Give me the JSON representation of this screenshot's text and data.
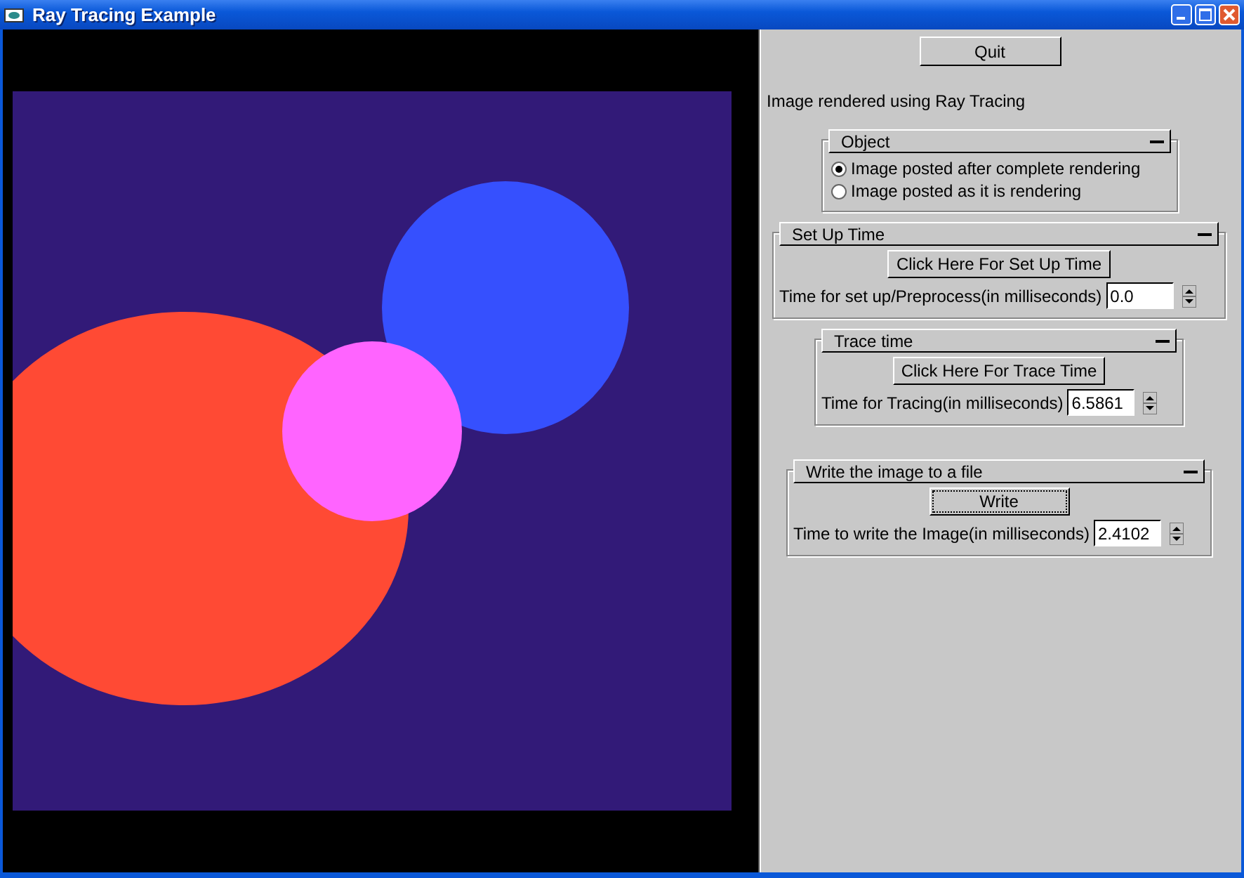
{
  "window": {
    "title": "Ray Tracing Example"
  },
  "quit_button": "Quit",
  "caption": "Image rendered using Ray Tracing",
  "groups": [
    {
      "kind": "radio",
      "title": "Object",
      "options": [
        {
          "label": "Image posted after complete rendering",
          "selected": true
        },
        {
          "label": "Image posted as it is rendering",
          "selected": false
        }
      ]
    },
    {
      "kind": "timing",
      "title": "Set Up Time",
      "button": "Click Here For Set Up Time",
      "button_focused": false,
      "field_label": "Time for set up/Preprocess(in milliseconds)",
      "value": "0.0"
    },
    {
      "kind": "timing",
      "title": "Trace time",
      "button": "Click Here For Trace Time",
      "button_focused": false,
      "field_label": "Time for Tracing(in milliseconds)",
      "value": "6.5861"
    },
    {
      "kind": "timing",
      "title": "Write the image to a file",
      "button": "Write",
      "button_focused": true,
      "field_label": "Time to write the Image(in milliseconds)",
      "value": "2.4102"
    }
  ]
}
